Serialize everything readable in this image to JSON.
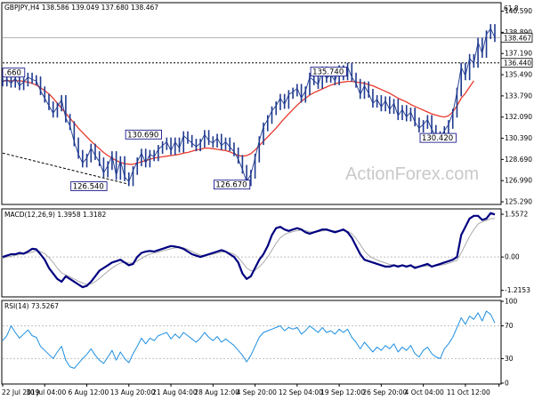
{
  "chart_data": [
    {
      "panel": "price",
      "type": "line",
      "title": "GBPJPY,H4  138.586 139.049 137.680 138.467",
      "instrument": "GBPJPY,H4",
      "ohlc": [
        "138.586",
        "139.049",
        "137.680",
        "138.467"
      ],
      "y_ticks": [
        125.29,
        126.99,
        128.69,
        130.39,
        132.09,
        133.79,
        135.49,
        137.19,
        138.89,
        140.59
      ],
      "y_tick_labels": [
        "125.290",
        "126.990",
        "128.690",
        "130.390",
        "132.090",
        "133.790",
        "135.490",
        "137.190",
        "138.890",
        "140.590"
      ],
      "ylim": [
        125.15,
        141.2
      ],
      "price_label": "138.467",
      "level_label": "136.440",
      "top_label": "61.8",
      "reference_lines": [
        {
          "value": 138.467,
          "label": "138.467",
          "style": "solid"
        },
        {
          "value": 136.44,
          "label": "136.440",
          "style": "dotted"
        }
      ],
      "annotations": [
        {
          "text": ".660",
          "x": 0.5,
          "y": 135.66
        },
        {
          "text": "126.540",
          "x": 20.5,
          "y": 126.54
        },
        {
          "text": "130.690",
          "x": 33.5,
          "y": 130.69
        },
        {
          "text": "126.670",
          "x": 54.5,
          "y": 126.67
        },
        {
          "text": "135.740",
          "x": 77.5,
          "y": 135.74
        },
        {
          "text": "130.420",
          "x": 103.5,
          "y": 130.42
        }
      ],
      "trendline": {
        "x": [
          0,
          30
        ],
        "y": [
          129.2,
          126.7
        ]
      },
      "series": [
        {
          "name": "close",
          "color": "#1f3a8f",
          "values": [
            134.9,
            135.1,
            134.8,
            135.2,
            134.6,
            134.9,
            135.3,
            135.1,
            135.0,
            134.2,
            133.6,
            133.0,
            132.4,
            132.9,
            133.5,
            132.0,
            131.4,
            130.1,
            129.1,
            128.4,
            128.8,
            129.6,
            129.0,
            128.5,
            127.6,
            128.2,
            129.0,
            127.4,
            128.6,
            127.3,
            126.9,
            127.8,
            128.5,
            129.2,
            128.4,
            129.1,
            128.9,
            129.5,
            129.8,
            130.1,
            129.4,
            130.1,
            129.6,
            130.6,
            130.3,
            130.0,
            129.7,
            130.0,
            130.7,
            130.2,
            130.0,
            130.4,
            129.8,
            130.1,
            129.7,
            129.3,
            128.7,
            127.9,
            126.9,
            127.5,
            128.8,
            130.2,
            131.3,
            131.9,
            132.6,
            133.0,
            133.6,
            133.1,
            133.9,
            134.1,
            134.4,
            133.6,
            134.2,
            135.3,
            135.0,
            134.7,
            135.8,
            135.2,
            135.5,
            135.0,
            135.9,
            135.4,
            136.1,
            135.3,
            134.8,
            133.9,
            134.6,
            134.0,
            133.2,
            133.5,
            132.9,
            133.4,
            132.7,
            133.2,
            132.2,
            132.7,
            132.1,
            132.5,
            131.7,
            131.2,
            131.5,
            131.9,
            131.1,
            130.6,
            130.4,
            131.0,
            131.5,
            132.4,
            134.1,
            136.1,
            135.4,
            136.8,
            136.4,
            138.1,
            137.2,
            138.7,
            139.2,
            138.47
          ]
        },
        {
          "name": "ma",
          "color": "#e83a2e",
          "values": [
            135.0,
            135.0,
            135.0,
            135.0,
            135.0,
            134.95,
            134.9,
            134.8,
            134.65,
            134.45,
            134.2,
            133.95,
            133.6,
            133.2,
            132.8,
            132.4,
            132.0,
            131.6,
            131.2,
            130.85,
            130.5,
            130.15,
            129.85,
            129.55,
            129.25,
            129.0,
            128.8,
            128.6,
            128.45,
            128.35,
            128.3,
            128.3,
            128.4,
            128.5,
            128.6,
            128.7,
            128.8,
            128.85,
            128.9,
            128.95,
            129.0,
            129.05,
            129.1,
            129.2,
            129.25,
            129.35,
            129.45,
            129.5,
            129.6,
            129.6,
            129.55,
            129.5,
            129.45,
            129.4,
            129.3,
            129.15,
            129.0,
            128.95,
            129.0,
            129.15,
            129.45,
            129.8,
            130.15,
            130.5,
            130.85,
            131.2,
            131.6,
            132.0,
            132.35,
            132.7,
            133.05,
            133.35,
            133.6,
            133.85,
            134.05,
            134.2,
            134.35,
            134.5,
            134.65,
            134.75,
            134.85,
            134.9,
            134.95,
            134.95,
            134.9,
            134.85,
            134.8,
            134.7,
            134.6,
            134.45,
            134.3,
            134.15,
            134.0,
            133.8,
            133.6,
            133.45,
            133.3,
            133.1,
            132.95,
            132.8,
            132.65,
            132.5,
            132.35,
            132.25,
            132.15,
            132.1,
            132.2,
            132.5,
            133.0,
            133.6,
            134.0,
            134.5,
            135.0
          ]
        }
      ]
    },
    {
      "panel": "macd",
      "type": "line",
      "title": "MACD(12,26,9) 1.3958 1.3182",
      "y_ticks": [
        1.5572,
        0.0,
        -1.2153
      ],
      "y_tick_labels": [
        "1.5572",
        "0.00",
        "-1.2153"
      ],
      "ylim": [
        -1.42,
        1.72
      ],
      "series": [
        {
          "name": "MACD",
          "color": "#000080",
          "values": [
            0.0,
            0.05,
            0.1,
            0.1,
            0.15,
            0.12,
            0.2,
            0.3,
            0.28,
            0.1,
            -0.1,
            -0.4,
            -0.6,
            -0.8,
            -0.9,
            -0.7,
            -0.8,
            -0.9,
            -1.0,
            -1.1,
            -1.05,
            -0.9,
            -0.7,
            -0.5,
            -0.4,
            -0.3,
            -0.2,
            -0.15,
            -0.1,
            -0.2,
            -0.3,
            -0.25,
            0.0,
            0.15,
            0.2,
            0.22,
            0.2,
            0.25,
            0.3,
            0.35,
            0.4,
            0.38,
            0.35,
            0.3,
            0.2,
            0.1,
            0.05,
            0.0,
            0.05,
            0.1,
            0.15,
            0.2,
            0.25,
            0.2,
            0.1,
            0.0,
            -0.2,
            -0.6,
            -0.8,
            -0.7,
            -0.4,
            -0.1,
            0.1,
            0.4,
            0.8,
            1.05,
            1.1,
            1.0,
            0.95,
            1.0,
            1.05,
            1.0,
            0.9,
            0.85,
            0.9,
            0.95,
            1.0,
            1.0,
            0.95,
            0.9,
            0.95,
            1.0,
            0.9,
            0.7,
            0.4,
            0.1,
            -0.1,
            -0.15,
            -0.2,
            -0.25,
            -0.3,
            -0.35,
            -0.35,
            -0.3,
            -0.35,
            -0.3,
            -0.35,
            -0.3,
            -0.4,
            -0.35,
            -0.3,
            -0.25,
            -0.35,
            -0.3,
            -0.25,
            -0.2,
            -0.15,
            -0.1,
            0.0,
            0.8,
            1.1,
            1.4,
            1.5,
            1.5,
            1.35,
            1.4,
            1.6,
            1.55
          ]
        },
        {
          "name": "Signal",
          "color": "#aaaaaa",
          "values": [
            -0.05,
            0.0,
            0.03,
            0.06,
            0.09,
            0.11,
            0.14,
            0.18,
            0.22,
            0.2,
            0.12,
            -0.02,
            -0.2,
            -0.4,
            -0.58,
            -0.65,
            -0.72,
            -0.8,
            -0.88,
            -0.95,
            -1.0,
            -0.98,
            -0.9,
            -0.78,
            -0.65,
            -0.52,
            -0.4,
            -0.3,
            -0.22,
            -0.2,
            -0.22,
            -0.22,
            -0.15,
            -0.05,
            0.04,
            0.1,
            0.14,
            0.18,
            0.22,
            0.26,
            0.3,
            0.33,
            0.34,
            0.33,
            0.28,
            0.2,
            0.13,
            0.07,
            0.06,
            0.07,
            0.1,
            0.14,
            0.18,
            0.19,
            0.16,
            0.1,
            -0.02,
            -0.2,
            -0.4,
            -0.5,
            -0.48,
            -0.36,
            -0.2,
            0.0,
            0.25,
            0.5,
            0.7,
            0.82,
            0.88,
            0.92,
            0.96,
            0.98,
            0.96,
            0.92,
            0.91,
            0.92,
            0.95,
            0.97,
            0.97,
            0.95,
            0.95,
            0.96,
            0.94,
            0.85,
            0.68,
            0.45,
            0.22,
            0.06,
            -0.04,
            -0.11,
            -0.17,
            -0.22,
            -0.27,
            -0.29,
            -0.31,
            -0.31,
            -0.32,
            -0.32,
            -0.34,
            -0.35,
            -0.34,
            -0.32,
            -0.33,
            -0.32,
            -0.3,
            -0.27,
            -0.23,
            -0.18,
            -0.12,
            0.15,
            0.45,
            0.75,
            1.0,
            1.2,
            1.28,
            1.33,
            1.4,
            1.4
          ]
        }
      ]
    },
    {
      "panel": "rsi",
      "type": "line",
      "title": "RSI(14) 73.5267",
      "y_ticks": [
        100,
        70,
        30,
        0
      ],
      "y_tick_labels": [
        "100",
        "70",
        "30",
        "0"
      ],
      "ylim": [
        0,
        100
      ],
      "series": [
        {
          "name": "RSI(14)",
          "color": "#1e8fe0",
          "values": [
            52,
            58,
            70,
            62,
            55,
            60,
            65,
            58,
            56,
            45,
            40,
            35,
            30,
            38,
            45,
            28,
            20,
            18,
            24,
            30,
            35,
            42,
            34,
            28,
            24,
            32,
            40,
            28,
            38,
            30,
            25,
            36,
            45,
            55,
            48,
            55,
            52,
            58,
            60,
            62,
            54,
            60,
            55,
            62,
            58,
            54,
            50,
            55,
            62,
            56,
            52,
            57,
            50,
            54,
            50,
            46,
            40,
            34,
            26,
            34,
            45,
            56,
            62,
            64,
            66,
            68,
            70,
            64,
            68,
            66,
            68,
            60,
            64,
            70,
            66,
            62,
            68,
            62,
            64,
            60,
            66,
            62,
            66,
            56,
            50,
            42,
            50,
            44,
            38,
            44,
            40,
            46,
            42,
            48,
            38,
            44,
            40,
            46,
            36,
            32,
            40,
            44,
            36,
            32,
            30,
            42,
            48,
            56,
            68,
            80,
            72,
            82,
            78,
            86,
            76,
            88,
            84,
            73.5267
          ]
        }
      ]
    },
    {
      "panel": "time_axis",
      "type": "table",
      "x_ticks": [
        0,
        10,
        20,
        30,
        40,
        50,
        60,
        70,
        80,
        90,
        100,
        110,
        118
      ],
      "x_tick_labels": [
        "22 Jul 2019",
        "30 Jul 04:00",
        "6 Aug 12:00",
        "13 Aug 20:00",
        "21 Aug 04:00",
        "28 Aug 12:00",
        "4 Sep 20:00",
        "12 Sep 04:00",
        "19 Sep 12:00",
        "26 Sep 20:00",
        "4 Oct 04:00",
        "11 Oct 12:00",
        ""
      ]
    }
  ],
  "watermark": "ActionForex.com"
}
